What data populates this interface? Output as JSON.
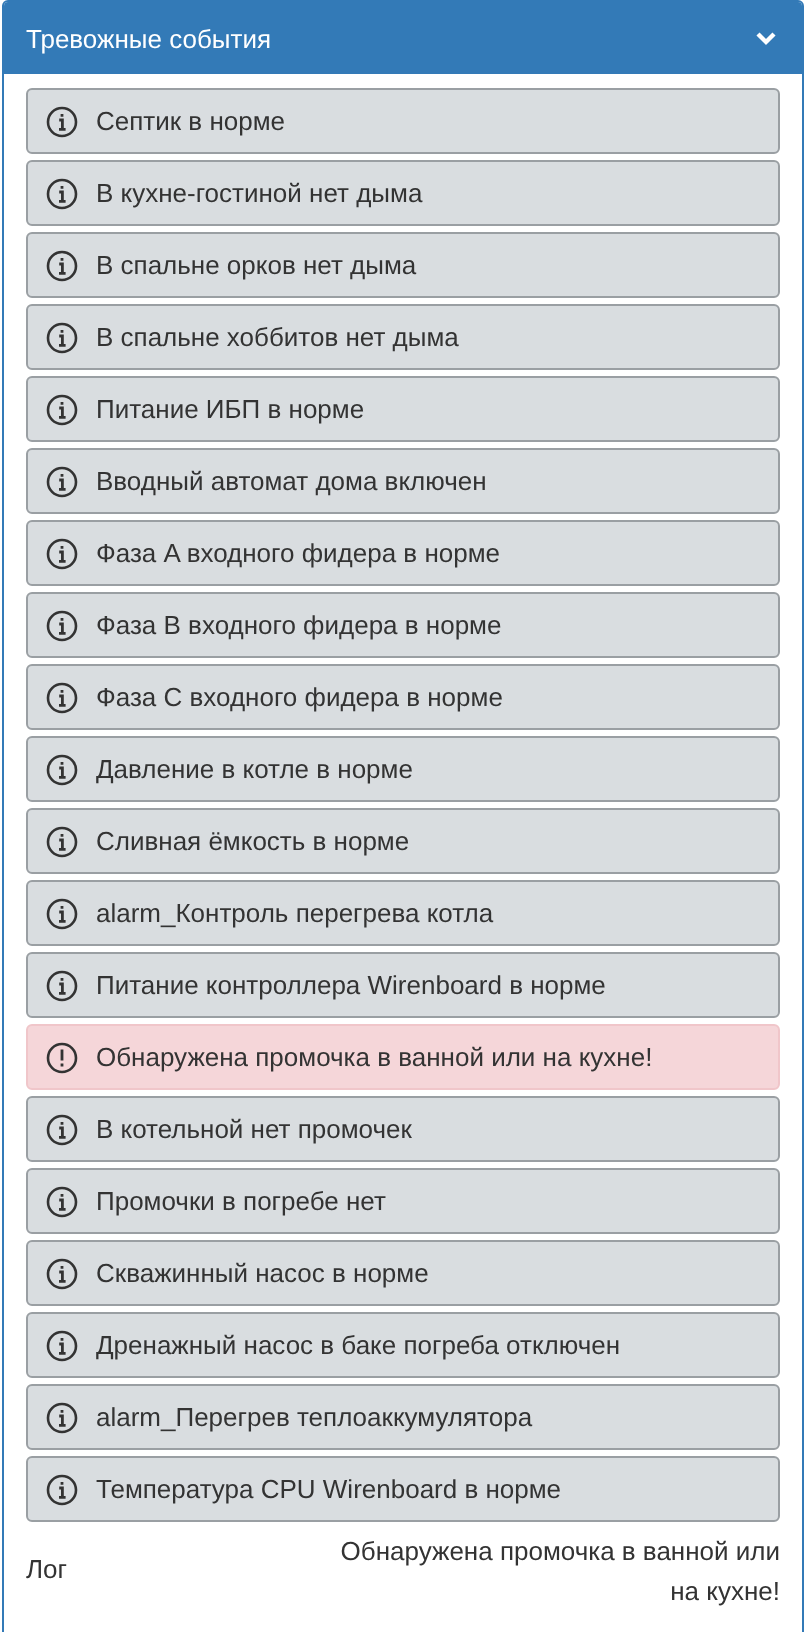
{
  "panel": {
    "title": "Тревожные события",
    "expanded": true
  },
  "events": [
    {
      "kind": "info",
      "text": "Септик в норме"
    },
    {
      "kind": "info",
      "text": "В кухне-гостиной нет дыма"
    },
    {
      "kind": "info",
      "text": "В спальне орков нет дыма"
    },
    {
      "kind": "info",
      "text": "В спальне хоббитов нет дыма"
    },
    {
      "kind": "info",
      "text": "Питание ИБП в норме"
    },
    {
      "kind": "info",
      "text": "Вводный автомат дома включен"
    },
    {
      "kind": "info",
      "text": "Фаза A входного фидера в норме"
    },
    {
      "kind": "info",
      "text": "Фаза B входного фидера в норме"
    },
    {
      "kind": "info",
      "text": "Фаза C входного фидера в норме"
    },
    {
      "kind": "info",
      "text": "Давление в котле в норме"
    },
    {
      "kind": "info",
      "text": "Сливная ёмкость в норме"
    },
    {
      "kind": "info",
      "text": "alarm_Контроль перегрева котла"
    },
    {
      "kind": "info",
      "text": "Питание контроллера Wirenboard в норме"
    },
    {
      "kind": "alarm",
      "text": "Обнаружена промочка в ванной или на кухне!"
    },
    {
      "kind": "info",
      "text": "В котельной нет промочек"
    },
    {
      "kind": "info",
      "text": "Промочки в погребе нет"
    },
    {
      "kind": "info",
      "text": "Скважинный насос в норме"
    },
    {
      "kind": "info",
      "text": "Дренажный насос в баке погреба отключен"
    },
    {
      "kind": "info",
      "text": "alarm_Перегрев теплоаккумулятора"
    },
    {
      "kind": "info",
      "text": "Температура CPU Wirenboard в норме"
    }
  ],
  "footer": {
    "log_link": "Лог",
    "last_message": "Обнаружена промочка в ванной или на кухне!"
  }
}
